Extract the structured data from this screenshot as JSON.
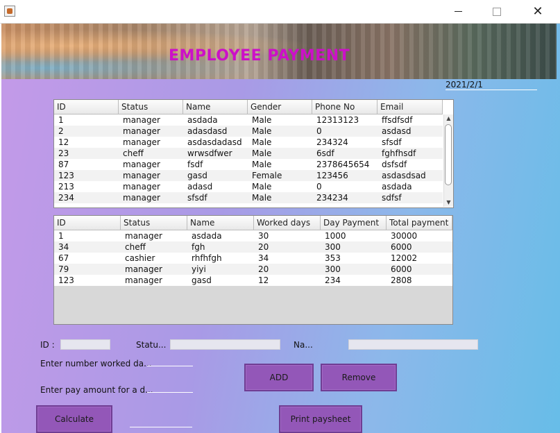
{
  "window": {
    "minimize_icon": "minimize-icon",
    "maximize_icon": "maximize-icon",
    "close_icon": "close-icon",
    "close_glyph": "✕"
  },
  "banner": {
    "title": "EMPLOYEE PAYMENT"
  },
  "date": "2021/2/1",
  "employees_table": {
    "columns": [
      "ID",
      "Status",
      "Name",
      "Gender",
      "Phone No",
      "Email"
    ],
    "rows": [
      [
        "1",
        "manager",
        "asdada",
        "Male",
        "12313123",
        "ffsdfsdf"
      ],
      [
        "2",
        "manager",
        "adasdasd",
        "Male",
        "0",
        "asdasd"
      ],
      [
        "12",
        "manager",
        "asdasdadasd",
        "Male",
        "234324",
        "sfsdf"
      ],
      [
        "23",
        "cheff",
        "wrwsdfwer",
        "Male",
        "6sdf",
        "fghfhsdf"
      ],
      [
        "87",
        "manager",
        "fsdf",
        "Male",
        "2378645654",
        "dsfsdf"
      ],
      [
        "123",
        "manager",
        "gasd",
        "Female",
        "123456",
        "asdasdsad"
      ],
      [
        "213",
        "manager",
        "adasd",
        "Male",
        "0",
        "asdada"
      ],
      [
        "234",
        "manager",
        "sfsdf",
        "Male",
        "234234",
        "sdfsf"
      ]
    ],
    "scroll_up_glyph": "▲",
    "scroll_down_glyph": "▼"
  },
  "payment_table": {
    "columns": [
      "ID",
      "Status",
      "Name",
      "Worked days",
      "Day Payment",
      "Total payment"
    ],
    "rows": [
      [
        "1",
        "manager",
        "asdada",
        "30",
        "1000",
        "30000"
      ],
      [
        "34",
        "cheff",
        "fgh",
        "20",
        "300",
        "6000"
      ],
      [
        "67",
        "cashier",
        "rhfhfgh",
        "34",
        "353",
        "12002"
      ],
      [
        "79",
        "manager",
        "yiyi",
        "20",
        "300",
        "6000"
      ],
      [
        "123",
        "manager",
        "gasd",
        "12",
        "234",
        "2808"
      ]
    ]
  },
  "form": {
    "id_label": "ID :",
    "status_label": "Statu...",
    "name_label": "Na...",
    "worked_days_label": "Enter number worked da...",
    "pay_amount_label": "Enter pay amount for a d..."
  },
  "buttons": {
    "add": "ADD",
    "remove": "Remove",
    "calculate": "Calculate",
    "print": "Print paysheet"
  }
}
